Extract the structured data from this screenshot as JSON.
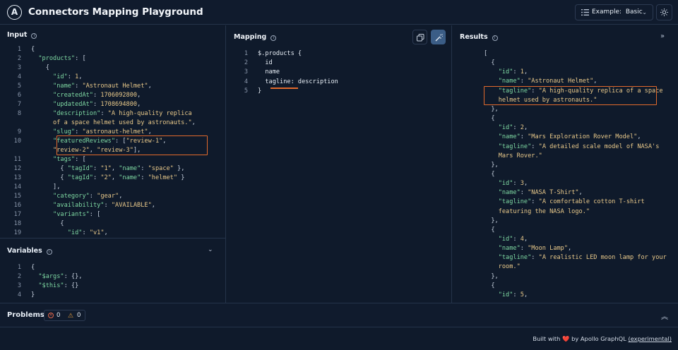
{
  "app": {
    "title": "Connectors Mapping Playground",
    "logo": "A"
  },
  "header": {
    "example_label": "Example:",
    "example_value": "Basic"
  },
  "input": {
    "title": "Input",
    "lines": [
      {
        "n": "1",
        "t": [
          [
            "{",
            "p"
          ]
        ]
      },
      {
        "n": "2",
        "t": [
          [
            "  ",
            "m"
          ],
          [
            "\"products\"",
            "k"
          ],
          [
            ": [",
            "p"
          ]
        ]
      },
      {
        "n": "3",
        "t": [
          [
            "    {",
            "p"
          ]
        ]
      },
      {
        "n": "4",
        "t": [
          [
            "      ",
            "m"
          ],
          [
            "\"id\"",
            "k"
          ],
          [
            ": ",
            "p"
          ],
          [
            "1",
            "n"
          ],
          [
            ",",
            "p"
          ]
        ]
      },
      {
        "n": "5",
        "t": [
          [
            "      ",
            "m"
          ],
          [
            "\"name\"",
            "k"
          ],
          [
            ": ",
            "p"
          ],
          [
            "\"Astronaut Helmet\"",
            "s"
          ],
          [
            ",",
            "p"
          ]
        ]
      },
      {
        "n": "6",
        "t": [
          [
            "      ",
            "m"
          ],
          [
            "\"createdAt\"",
            "k"
          ],
          [
            ": ",
            "p"
          ],
          [
            "1706092800",
            "n"
          ],
          [
            ",",
            "p"
          ]
        ]
      },
      {
        "n": "7",
        "t": [
          [
            "      ",
            "m"
          ],
          [
            "\"updatedAt\"",
            "k"
          ],
          [
            ": ",
            "p"
          ],
          [
            "1708694800",
            "n"
          ],
          [
            ",",
            "p"
          ]
        ]
      },
      {
        "n": "8",
        "t": [
          [
            "      ",
            "m"
          ],
          [
            "\"description\"",
            "k"
          ],
          [
            ": ",
            "p"
          ],
          [
            "\"A high-quality replica",
            "s"
          ]
        ]
      },
      {
        "n": "",
        "t": [
          [
            "      ",
            "m"
          ],
          [
            "of a space helmet used by astronauts.\"",
            "s"
          ],
          [
            ",",
            "p"
          ]
        ]
      },
      {
        "n": "9",
        "t": [
          [
            "      ",
            "m"
          ],
          [
            "\"slug\"",
            "k"
          ],
          [
            ": ",
            "p"
          ],
          [
            "\"astronaut-helmet\"",
            "s"
          ],
          [
            ",",
            "p"
          ]
        ]
      },
      {
        "n": "10",
        "t": [
          [
            "      ",
            "m"
          ],
          [
            "\"featuredReviews\"",
            "k"
          ],
          [
            ": [",
            "p"
          ],
          [
            "\"review-1\"",
            "s"
          ],
          [
            ",",
            "p"
          ]
        ]
      },
      {
        "n": "",
        "t": [
          [
            "      ",
            "m"
          ],
          [
            "\"review-2\"",
            "s"
          ],
          [
            ", ",
            "p"
          ],
          [
            "\"review-3\"",
            "s"
          ],
          [
            "],",
            "p"
          ]
        ]
      },
      {
        "n": "11",
        "t": [
          [
            "      ",
            "m"
          ],
          [
            "\"tags\"",
            "k"
          ],
          [
            ": [",
            "p"
          ]
        ]
      },
      {
        "n": "12",
        "t": [
          [
            "        { ",
            "p"
          ],
          [
            "\"tagId\"",
            "k"
          ],
          [
            ": ",
            "p"
          ],
          [
            "\"1\"",
            "s"
          ],
          [
            ", ",
            "p"
          ],
          [
            "\"name\"",
            "k"
          ],
          [
            ": ",
            "p"
          ],
          [
            "\"space\"",
            "s"
          ],
          [
            " },",
            "p"
          ]
        ]
      },
      {
        "n": "13",
        "t": [
          [
            "        { ",
            "p"
          ],
          [
            "\"tagId\"",
            "k"
          ],
          [
            ": ",
            "p"
          ],
          [
            "\"2\"",
            "s"
          ],
          [
            ", ",
            "p"
          ],
          [
            "\"name\"",
            "k"
          ],
          [
            ": ",
            "p"
          ],
          [
            "\"helmet\"",
            "s"
          ],
          [
            " }",
            "p"
          ]
        ]
      },
      {
        "n": "14",
        "t": [
          [
            "      ],",
            "p"
          ]
        ]
      },
      {
        "n": "15",
        "t": [
          [
            "      ",
            "m"
          ],
          [
            "\"category\"",
            "k"
          ],
          [
            ": ",
            "p"
          ],
          [
            "\"gear\"",
            "s"
          ],
          [
            ",",
            "p"
          ]
        ]
      },
      {
        "n": "16",
        "t": [
          [
            "      ",
            "m"
          ],
          [
            "\"availability\"",
            "k"
          ],
          [
            ": ",
            "p"
          ],
          [
            "\"AVAILABLE\"",
            "s"
          ],
          [
            ",",
            "p"
          ]
        ]
      },
      {
        "n": "17",
        "t": [
          [
            "      ",
            "m"
          ],
          [
            "\"variants\"",
            "k"
          ],
          [
            ": [",
            "p"
          ]
        ]
      },
      {
        "n": "18",
        "t": [
          [
            "        {",
            "p"
          ]
        ]
      },
      {
        "n": "19",
        "t": [
          [
            "          ",
            "m"
          ],
          [
            "\"id\"",
            "k"
          ],
          [
            ": ",
            "p"
          ],
          [
            "\"v1\"",
            "s"
          ],
          [
            ",",
            "p"
          ]
        ]
      }
    ]
  },
  "variables": {
    "title": "Variables",
    "lines": [
      {
        "n": "1",
        "t": [
          [
            "{",
            "p"
          ]
        ]
      },
      {
        "n": "2",
        "t": [
          [
            "  ",
            "m"
          ],
          [
            "\"$args\"",
            "k"
          ],
          [
            ": {},",
            "p"
          ]
        ]
      },
      {
        "n": "3",
        "t": [
          [
            "  ",
            "m"
          ],
          [
            "\"$this\"",
            "k"
          ],
          [
            ": {}",
            "p"
          ]
        ]
      },
      {
        "n": "4",
        "t": [
          [
            "}",
            "p"
          ]
        ]
      }
    ]
  },
  "mapping": {
    "title": "Mapping",
    "lines": [
      {
        "n": "1",
        "t": [
          [
            "$.products {",
            "m"
          ]
        ]
      },
      {
        "n": "2",
        "t": [
          [
            "  id",
            "m"
          ]
        ]
      },
      {
        "n": "3",
        "t": [
          [
            "  name",
            "m"
          ]
        ]
      },
      {
        "n": "4",
        "t": [
          [
            "  tagline: description",
            "m"
          ]
        ]
      },
      {
        "n": "5",
        "t": [
          [
            "}",
            "m"
          ]
        ]
      }
    ]
  },
  "results": {
    "title": "Results",
    "lines": [
      {
        "n": "",
        "t": [
          [
            "[",
            "p"
          ]
        ]
      },
      {
        "n": "",
        "t": [
          [
            "  {",
            "p"
          ]
        ]
      },
      {
        "n": "",
        "t": [
          [
            "    ",
            "m"
          ],
          [
            "\"id\"",
            "k"
          ],
          [
            ": ",
            "p"
          ],
          [
            "1",
            "n"
          ],
          [
            ",",
            "p"
          ]
        ]
      },
      {
        "n": "",
        "t": [
          [
            "    ",
            "m"
          ],
          [
            "\"name\"",
            "k"
          ],
          [
            ": ",
            "p"
          ],
          [
            "\"Astronaut Helmet\"",
            "s"
          ],
          [
            ",",
            "p"
          ]
        ]
      },
      {
        "n": "",
        "t": [
          [
            "    ",
            "m"
          ],
          [
            "\"tagline\"",
            "k"
          ],
          [
            ": ",
            "p"
          ],
          [
            "\"A high-quality replica of a space",
            "s"
          ]
        ]
      },
      {
        "n": "",
        "t": [
          [
            "    ",
            "m"
          ],
          [
            "helmet used by astronauts.\"",
            "s"
          ]
        ]
      },
      {
        "n": "",
        "t": [
          [
            "  },",
            "p"
          ]
        ]
      },
      {
        "n": "",
        "t": [
          [
            "  {",
            "p"
          ]
        ]
      },
      {
        "n": "",
        "t": [
          [
            "    ",
            "m"
          ],
          [
            "\"id\"",
            "k"
          ],
          [
            ": ",
            "p"
          ],
          [
            "2",
            "n"
          ],
          [
            ",",
            "p"
          ]
        ]
      },
      {
        "n": "",
        "t": [
          [
            "    ",
            "m"
          ],
          [
            "\"name\"",
            "k"
          ],
          [
            ": ",
            "p"
          ],
          [
            "\"Mars Exploration Rover Model\"",
            "s"
          ],
          [
            ",",
            "p"
          ]
        ]
      },
      {
        "n": "",
        "t": [
          [
            "    ",
            "m"
          ],
          [
            "\"tagline\"",
            "k"
          ],
          [
            ": ",
            "p"
          ],
          [
            "\"A detailed scale model of NASA's",
            "s"
          ]
        ]
      },
      {
        "n": "",
        "t": [
          [
            "    ",
            "m"
          ],
          [
            "Mars Rover.\"",
            "s"
          ]
        ]
      },
      {
        "n": "",
        "t": [
          [
            "  },",
            "p"
          ]
        ]
      },
      {
        "n": "",
        "t": [
          [
            "  {",
            "p"
          ]
        ]
      },
      {
        "n": "",
        "t": [
          [
            "    ",
            "m"
          ],
          [
            "\"id\"",
            "k"
          ],
          [
            ": ",
            "p"
          ],
          [
            "3",
            "n"
          ],
          [
            ",",
            "p"
          ]
        ]
      },
      {
        "n": "",
        "t": [
          [
            "    ",
            "m"
          ],
          [
            "\"name\"",
            "k"
          ],
          [
            ": ",
            "p"
          ],
          [
            "\"NASA T-Shirt\"",
            "s"
          ],
          [
            ",",
            "p"
          ]
        ]
      },
      {
        "n": "",
        "t": [
          [
            "    ",
            "m"
          ],
          [
            "\"tagline\"",
            "k"
          ],
          [
            ": ",
            "p"
          ],
          [
            "\"A comfortable cotton T-shirt",
            "s"
          ]
        ]
      },
      {
        "n": "",
        "t": [
          [
            "    ",
            "m"
          ],
          [
            "featuring the NASA logo.\"",
            "s"
          ]
        ]
      },
      {
        "n": "",
        "t": [
          [
            "  },",
            "p"
          ]
        ]
      },
      {
        "n": "",
        "t": [
          [
            "  {",
            "p"
          ]
        ]
      },
      {
        "n": "",
        "t": [
          [
            "    ",
            "m"
          ],
          [
            "\"id\"",
            "k"
          ],
          [
            ": ",
            "p"
          ],
          [
            "4",
            "n"
          ],
          [
            ",",
            "p"
          ]
        ]
      },
      {
        "n": "",
        "t": [
          [
            "    ",
            "m"
          ],
          [
            "\"name\"",
            "k"
          ],
          [
            ": ",
            "p"
          ],
          [
            "\"Moon Lamp\"",
            "s"
          ],
          [
            ",",
            "p"
          ]
        ]
      },
      {
        "n": "",
        "t": [
          [
            "    ",
            "m"
          ],
          [
            "\"tagline\"",
            "k"
          ],
          [
            ": ",
            "p"
          ],
          [
            "\"A realistic LED moon lamp for your",
            "s"
          ]
        ]
      },
      {
        "n": "",
        "t": [
          [
            "    ",
            "m"
          ],
          [
            "room.\"",
            "s"
          ]
        ]
      },
      {
        "n": "",
        "t": [
          [
            "  },",
            "p"
          ]
        ]
      },
      {
        "n": "",
        "t": [
          [
            "  {",
            "p"
          ]
        ]
      },
      {
        "n": "",
        "t": [
          [
            "    ",
            "m"
          ],
          [
            "\"id\"",
            "k"
          ],
          [
            ": ",
            "p"
          ],
          [
            "5",
            "n"
          ],
          [
            ",",
            "p"
          ]
        ]
      }
    ]
  },
  "problems": {
    "title": "Problems",
    "errors": "0",
    "warnings": "0"
  },
  "footer": {
    "built_with": "Built with",
    "heart": "❤️",
    "by": "by Apollo GraphQL",
    "link": "(experimental)"
  },
  "colors": {
    "background": "#0f1a2b",
    "key": "#7ed8a2",
    "string": "#e9c98a",
    "highlight": "#e26a2c",
    "accent": "#3b5d86"
  }
}
